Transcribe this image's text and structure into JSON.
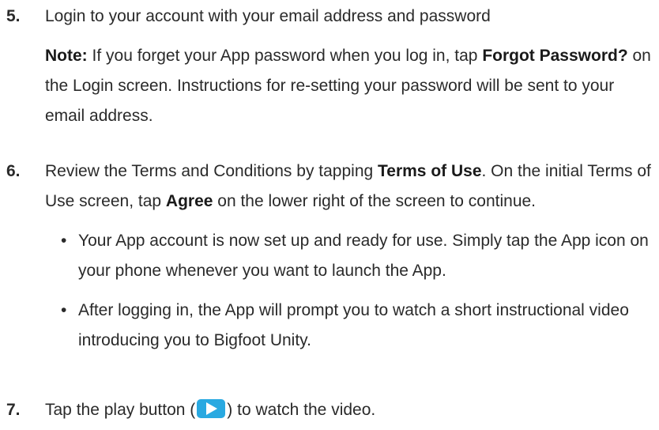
{
  "steps": [
    {
      "number": "5.",
      "text": "Login to your account with your email address and password",
      "note": {
        "label": "Note:",
        "text_a": " If you forget your App password when you log in, tap ",
        "bold_a": "Forgot Password?",
        "text_b": " on the Login screen. Instructions for re-setting your password will be sent to your email address."
      }
    },
    {
      "number": "6.",
      "text_a": "Review the Terms and Conditions by tapping ",
      "bold_a": "Terms of Use",
      "text_b": ". On the initial Terms of Use screen, tap ",
      "bold_b": "Agree",
      "text_c": " on the lower right of the screen to continue.",
      "bullets": [
        "Your App account is now set up and ready for use. Simply tap the App icon on your phone whenever you want to launch the App.",
        "After logging in, the App will prompt you to watch a short instructional video introducing you to Bigfoot Unity."
      ]
    },
    {
      "number": "7.",
      "text_a": "Tap the play button (",
      "icon": "play-icon",
      "text_b": ") to watch the video."
    }
  ],
  "bullet_char": "•",
  "colors": {
    "text": "#2a2a2a",
    "play_button": "#29a9e1"
  }
}
